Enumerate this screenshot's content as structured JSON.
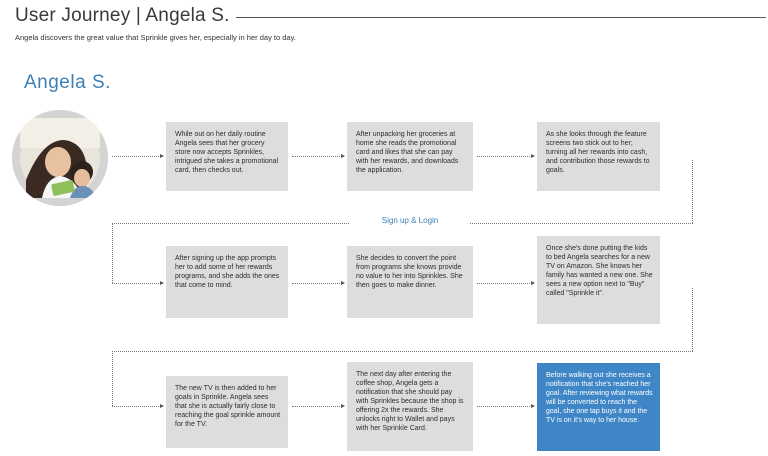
{
  "header": {
    "title": "User Journey | Angela S.",
    "subtitle": "Angela discovers the great value that Sprinkle gives her, especially in her day to day."
  },
  "persona": {
    "name": "Angela S."
  },
  "step_label": "Sign up & Login",
  "cards": [
    {
      "text": "While out on her daily routine Angela sees that her grocery store now accepts Sprinkles, intrigued she takes a promotional card, then checks out."
    },
    {
      "text": "After unpacking her groceries at home she reads the promotional card and likes that she can pay with her rewards, and downloads the application."
    },
    {
      "text": "As she looks through the feature screens two stick out to her; turning all her rewards into cash, and contribution those rewards to goals."
    },
    {
      "text": "After signing up the app prompts her to add some of her rewards programs, and she adds the ones that come to mind."
    },
    {
      "text": "She decides to convert the point from programs she knows provide no value to her into Sprinkles. She then goes to make dinner."
    },
    {
      "text": "Once she's done putting the kids to bed Angela searches for a new TV on Amazon. She knows her family has wanted a new one. She sees a new option next to \"Buy\" called \"Sprinkle it\"."
    },
    {
      "text": "The new TV is then added to her goals in Sprinkle. Angela sees that she is actually fairly close to reaching the goal sprinkle amount for the TV."
    },
    {
      "text": "The next day after entering the coffee shop, Angela gets a notification that she should pay with Sprinkles because the shop is offering 2x the rewards. She unlocks right to Wallet and pays with her Sprinkle Card."
    },
    {
      "text": "Before walking out she receives a notification that she's reached her goal. After reviewing what rewards will be converted to reach the goal, she one tap buys it and the TV is on it's way to her house."
    }
  ],
  "colors": {
    "accent": "#3d7fb6",
    "highlight_card": "#3f86c7",
    "card": "#dddddd"
  }
}
